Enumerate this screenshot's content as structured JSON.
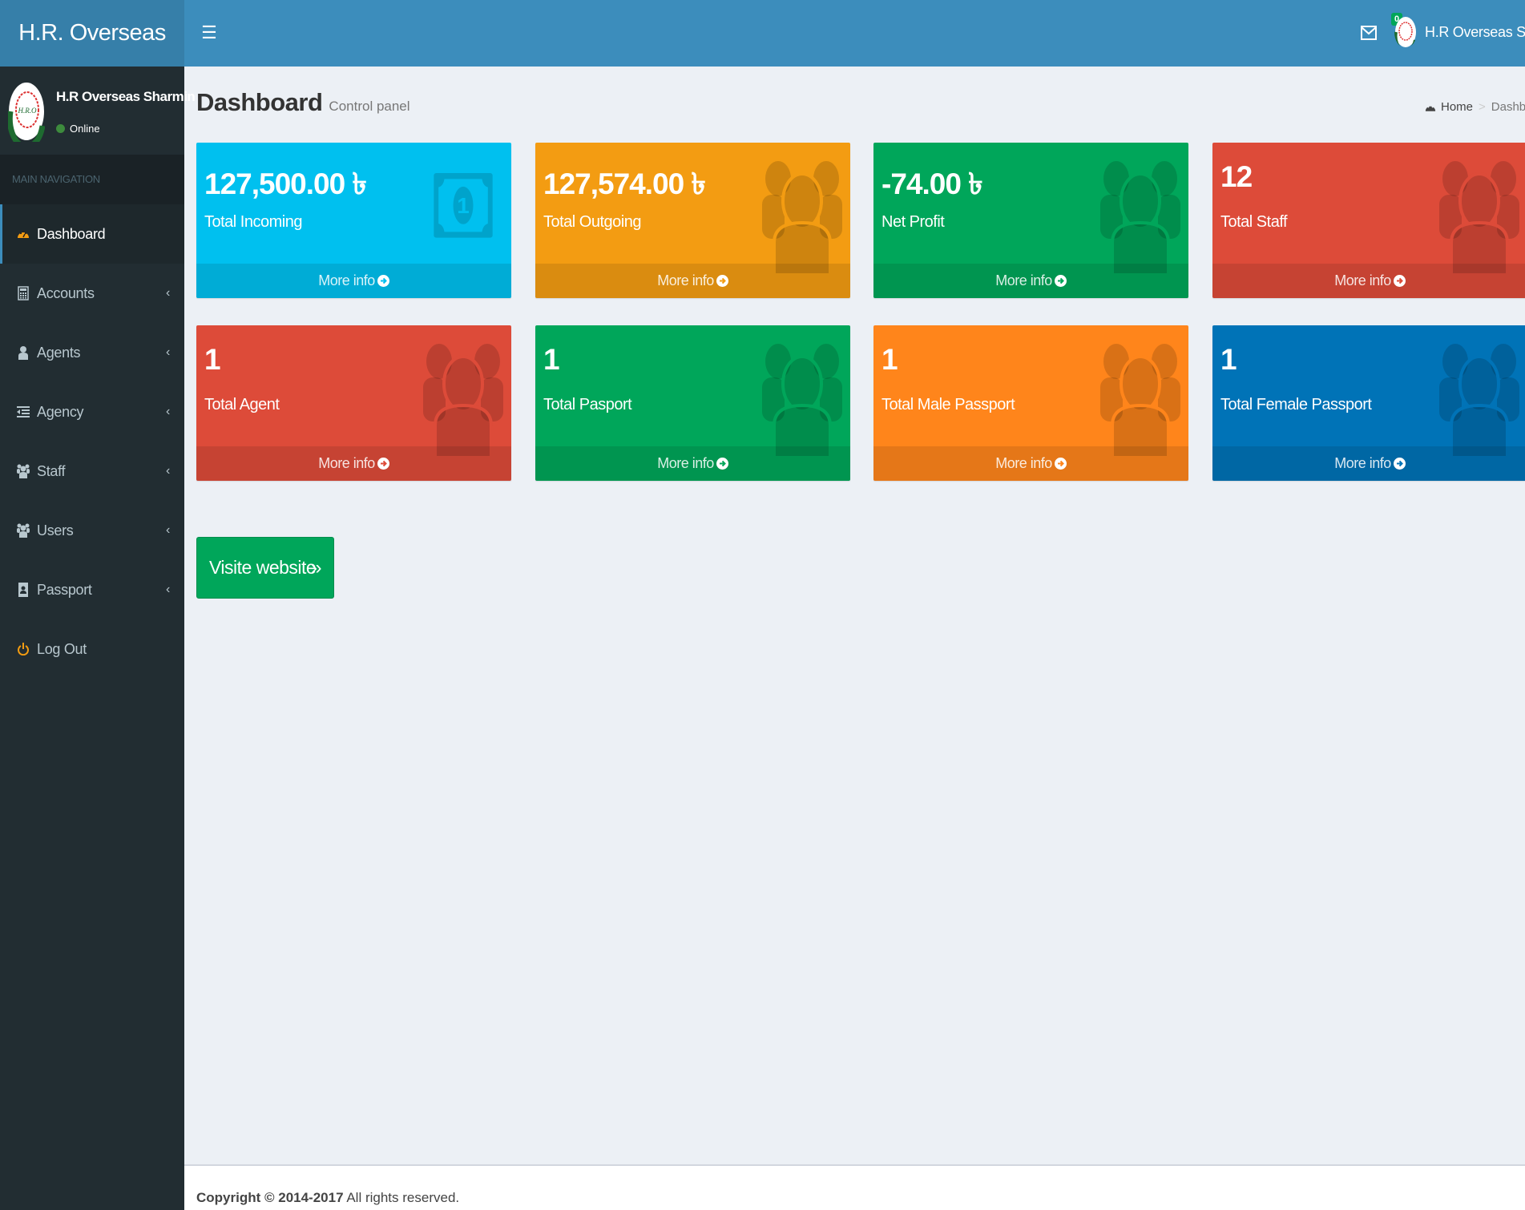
{
  "header": {
    "logo": "H.R. Overseas",
    "toggle_icon": "hamburger-icon",
    "mail_badge": "0",
    "user_name": "H.R Overseas Sharmin"
  },
  "sidebar": {
    "user": {
      "name": "H.R Overseas Sharmin",
      "status": "Online"
    },
    "nav_header": "MAIN NAVIGATION",
    "items": [
      {
        "label": "Dashboard",
        "icon": "dashboard-icon",
        "active": true,
        "has_children": false
      },
      {
        "label": "Accounts",
        "icon": "calculator-icon",
        "active": false,
        "has_children": true
      },
      {
        "label": "Agents",
        "icon": "user-icon",
        "active": false,
        "has_children": true
      },
      {
        "label": "Agency",
        "icon": "indent-list-icon",
        "active": false,
        "has_children": true
      },
      {
        "label": "Staff",
        "icon": "users-icon",
        "active": false,
        "has_children": true
      },
      {
        "label": "Users",
        "icon": "users-icon",
        "active": false,
        "has_children": true
      },
      {
        "label": "Passport",
        "icon": "address-book-icon",
        "active": false,
        "has_children": true
      },
      {
        "label": "Log Out",
        "icon": "power-icon",
        "active": false,
        "has_children": false
      }
    ]
  },
  "content": {
    "title": "Dashboard",
    "subtitle": "Control panel",
    "breadcrumb": {
      "home": "Home",
      "current": "Dashboard"
    }
  },
  "boxes": [
    {
      "value": "127,500.00 ৳",
      "label": "Total Incoming",
      "more": "More info",
      "color": "#00c0ef",
      "icon": "money-icon"
    },
    {
      "value": "127,574.00 ৳",
      "label": "Total Outgoing",
      "more": "More info",
      "color": "#f39c12",
      "icon": "users-icon"
    },
    {
      "value": "-74.00 ৳",
      "label": "Net Profit",
      "more": "More info",
      "color": "#00a65a",
      "icon": "users-icon"
    },
    {
      "value": "12",
      "label": "Total Staff",
      "more": "More info",
      "color": "#dd4b39",
      "icon": "users-icon"
    },
    {
      "value": "1",
      "label": "Total Agent",
      "more": "More info",
      "color": "#dd4b39",
      "icon": "users-icon"
    },
    {
      "value": "1",
      "label": "Total Pasport",
      "more": "More info",
      "color": "#00a65a",
      "icon": "users-icon"
    },
    {
      "value": "1",
      "label": "Total Male Passport",
      "more": "More info",
      "color": "#ff851b",
      "icon": "users-icon"
    },
    {
      "value": "1",
      "label": "Total Female Passport",
      "more": "More info",
      "color": "#0073b7",
      "icon": "users-icon"
    }
  ],
  "visit_button": {
    "label": "Visite website",
    "icon": "double-chevron-right-icon"
  },
  "footer": {
    "copyright": "Copyright © 2014-2017",
    "rights": "All rights reserved."
  }
}
